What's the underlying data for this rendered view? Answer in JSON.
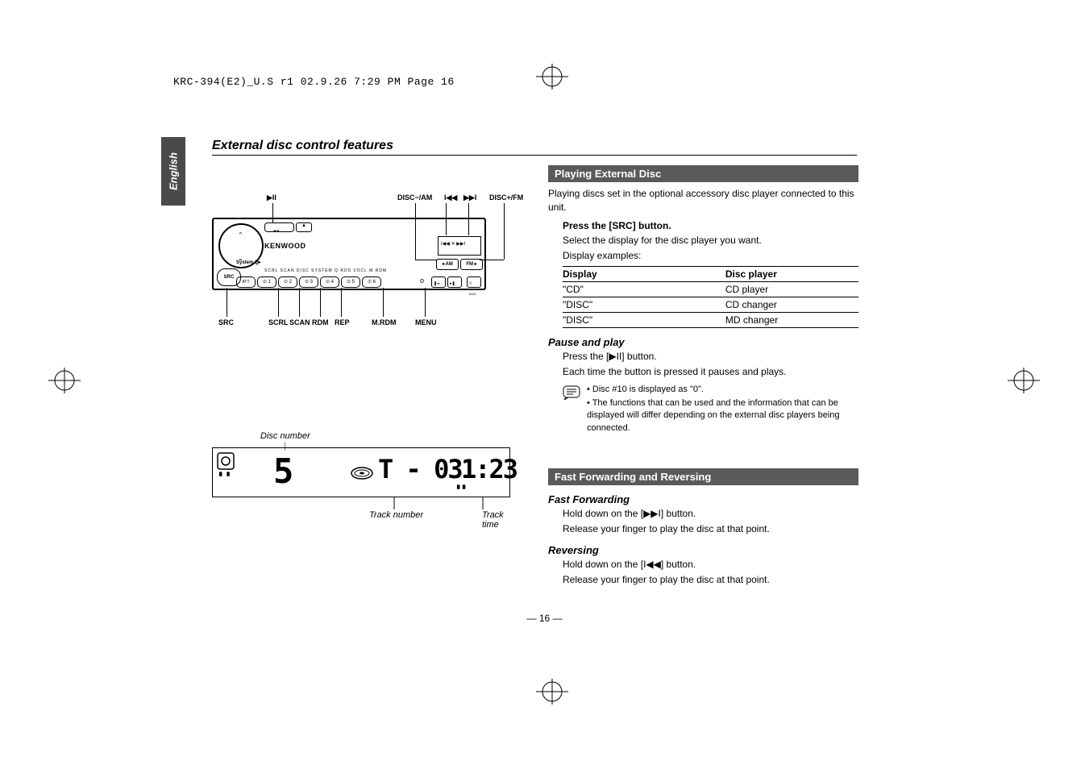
{
  "print_header": "KRC-394(E2)_U.S r1  02.9.26  7:29 PM  Page 16",
  "side_tab": "English",
  "section_title": "External disc control features",
  "device": {
    "brand": "KENWOOD",
    "callouts": {
      "play_pause": "▶II",
      "disc_minus_am": "DISC−/AM",
      "prev": "I◀◀",
      "next": "▶▶I",
      "disc_plus_fm": "DISC+/FM",
      "src": "SRC",
      "scrl": "SCRL",
      "scan": "SCAN",
      "rdm": "RDM",
      "rep": "REP",
      "mrdm": "M.RDM",
      "menu": "MENU"
    },
    "buttons": {
      "src": "SRC",
      "att": "ATT",
      "am": "◂ AM",
      "fm": "FM ▸",
      "eject": "▲",
      "small_row": "SCRL   SCAN   DISC   SYSTEM Q   RDS       VOCL    M.RDM",
      "presets": [
        "⊙ 1",
        "⊙ 2",
        "⊙ 3",
        "⊙ 4",
        "⊙ 5",
        "⊙ 6"
      ]
    },
    "lcd_icons": "I◀◀ ✕ ▶▶I"
  },
  "lcd": {
    "disc_number_label": "Disc number",
    "track_number_label": "Track number",
    "track_time_label": "Track time",
    "disc_value": "5",
    "track_value": "T - 03",
    "time_value": "1:23"
  },
  "playing": {
    "heading": "Playing External Disc",
    "intro": "Playing discs set in the optional accessory disc player connected to this unit.",
    "step1": "Press the [SRC] button.",
    "step2": "Select the display for the disc player you want.",
    "step3": "Display examples:",
    "table": {
      "headers": [
        "Display",
        "Disc player"
      ],
      "rows": [
        [
          "\"CD\"",
          "CD player"
        ],
        [
          "\"DISC\"",
          "CD changer"
        ],
        [
          "\"DISC\"",
          "MD changer"
        ]
      ]
    }
  },
  "pause": {
    "heading": "Pause and play",
    "step1a": "Press the [",
    "step1b": "] button.",
    "glyph": "▶II",
    "step2": "Each time the button is pressed it pauses and plays."
  },
  "notes": {
    "n1": "• Disc #10 is displayed as \"0\".",
    "n2": "• The functions that can be used and the information that can be displayed will differ depending on the external disc players being connected."
  },
  "fastfwd": {
    "heading": "Fast Forwarding and Reversing",
    "sub1": "Fast Forwarding",
    "s1a": "Hold down on the [",
    "s1glyph": "▶▶I",
    "s1b": "] button.",
    "s1r": "Release your finger to play the disc at that point.",
    "sub2": "Reversing",
    "s2a": "Hold down on the [",
    "s2glyph": "I◀◀",
    "s2b": "] button.",
    "s2r": "Release your finger to play the disc at that point."
  },
  "pagenum": "— 16 —"
}
